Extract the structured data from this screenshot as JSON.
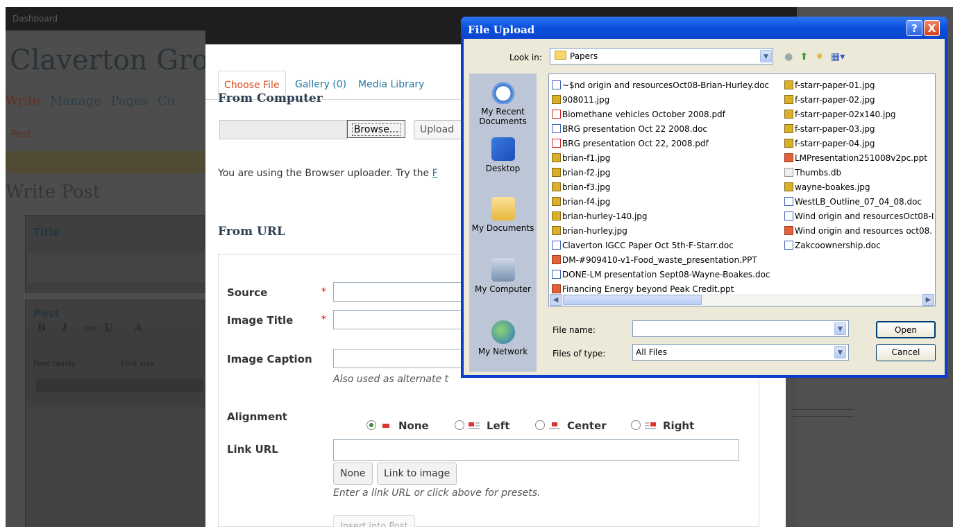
{
  "wp": {
    "topbar_label": "Dashboard",
    "site_title": "Claverton Grou",
    "tabs": [
      "Write",
      "Manage",
      "Pages",
      "Co"
    ],
    "subnav": "Post",
    "heading": "Write Post",
    "title_box": "Title",
    "post_box": "Post",
    "toolbar": {
      "bold": "B",
      "italic": "I",
      "strike": "ABC",
      "underline": "U",
      "color": "A"
    },
    "font_family": "Font family",
    "font_size": "Font size"
  },
  "modal": {
    "tabs": [
      "Choose File",
      "Gallery (0)",
      "Media Library"
    ],
    "from_computer": "From Computer",
    "browse": "Browse...",
    "upload": "Upload",
    "browser_msg": "You are using the Browser uploader. Try the ",
    "browser_msg_link": "F",
    "from_url": "From URL",
    "source_label": "Source",
    "image_title_label": "Image Title",
    "required_mark": "*",
    "image_caption_label": "Image Caption",
    "caption_hint": "Also used as alternate t",
    "alignment_label": "Alignment",
    "alignment_options": [
      "None",
      "Left",
      "Center",
      "Right"
    ],
    "alignment_selected": "None",
    "link_url_label": "Link URL",
    "link_none": "None",
    "link_to_image": "Link to image",
    "link_hint": "Enter a link URL or click above for presets.",
    "insert_button": "Insert into Post"
  },
  "dialog": {
    "title": "File Upload",
    "help": "?",
    "close": "X",
    "look_in_label": "Look in:",
    "look_in_value": "Papers",
    "places": [
      "My Recent Documents",
      "Desktop",
      "My Documents",
      "My Computer",
      "My Network"
    ],
    "files_col1": [
      {
        "name": "~$nd origin and resourcesOct08-Brian-Hurley.doc",
        "type": "doc"
      },
      {
        "name": "908011.jpg",
        "type": "jpg"
      },
      {
        "name": "Biomethane vehicles October 2008.pdf",
        "type": "pdf"
      },
      {
        "name": "BRG presentation Oct 22 2008.doc",
        "type": "doc"
      },
      {
        "name": "BRG presentation Oct 22, 2008.pdf",
        "type": "pdf"
      },
      {
        "name": "brian-f1.jpg",
        "type": "jpg"
      },
      {
        "name": "brian-f2.jpg",
        "type": "jpg"
      },
      {
        "name": "brian-f3.jpg",
        "type": "jpg"
      },
      {
        "name": "brian-f4.jpg",
        "type": "jpg"
      },
      {
        "name": "brian-hurley-140.jpg",
        "type": "jpg"
      },
      {
        "name": "brian-hurley.jpg",
        "type": "jpg"
      },
      {
        "name": "Claverton IGCC Paper Oct 5th-F-Starr.doc",
        "type": "doc"
      },
      {
        "name": "DM-#909410-v1-Food_waste_presentation.PPT",
        "type": "ppt"
      },
      {
        "name": "DONE-LM presentation Sept08-Wayne-Boakes.doc",
        "type": "doc"
      },
      {
        "name": "Financing Energy beyond Peak Credit.ppt",
        "type": "ppt"
      }
    ],
    "files_col2": [
      {
        "name": "f-starr-paper-01.jpg",
        "type": "jpg"
      },
      {
        "name": "f-starr-paper-02.jpg",
        "type": "jpg"
      },
      {
        "name": "f-starr-paper-02x140.jpg",
        "type": "jpg"
      },
      {
        "name": "f-starr-paper-03.jpg",
        "type": "jpg"
      },
      {
        "name": "f-starr-paper-04.jpg",
        "type": "jpg"
      },
      {
        "name": "LMPresentation251008v2pc.ppt",
        "type": "ppt"
      },
      {
        "name": "Thumbs.db",
        "type": "db"
      },
      {
        "name": "wayne-boakes.jpg",
        "type": "jpg"
      },
      {
        "name": "WestLB_Outline_07_04_08.doc",
        "type": "doc"
      },
      {
        "name": "Wind origin and resourcesOct08-I",
        "type": "doc"
      },
      {
        "name": "Wind origin and resources oct08.",
        "type": "ppt"
      },
      {
        "name": "Zakcoownership.doc",
        "type": "doc"
      }
    ],
    "file_name_label": "File name:",
    "file_name_value": "",
    "files_of_type_label": "Files of type:",
    "files_of_type_value": "All Files",
    "open_button": "Open",
    "cancel_button": "Cancel"
  }
}
